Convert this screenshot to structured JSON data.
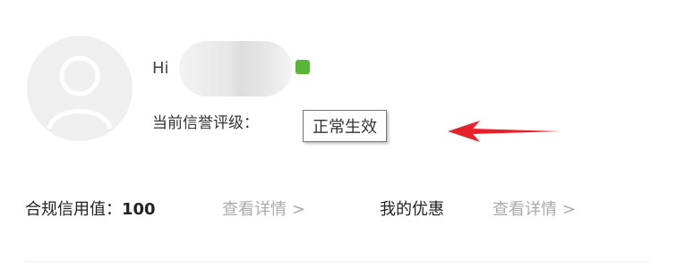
{
  "profile": {
    "greeting": "Hi",
    "status_color": "#5bb534",
    "avatar_icon": "user-avatar-placeholder-icon"
  },
  "credit": {
    "label": "当前信誉评级：",
    "status": "正常生效"
  },
  "annotation": {
    "arrow_color": "#e8202a",
    "icon": "red-arrow-icon"
  },
  "metrics": {
    "compliance_label": "合规信用值：",
    "compliance_value": "100",
    "view_details_1": "查看详情 >",
    "my_discount_label": "我的优惠",
    "view_details_2": "查看详情 >"
  }
}
